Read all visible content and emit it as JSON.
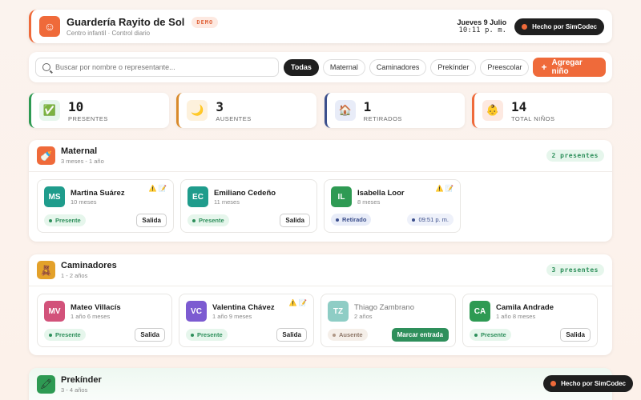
{
  "header": {
    "title": "Guardería Rayito de Sol",
    "badge": "DEMO",
    "subtitle": "Centro infantil · Control diario",
    "date": "Jueves 9 Julio",
    "time": "10:11 p. m.",
    "made_by": "Hecho por SimCodec"
  },
  "toolbar": {
    "search_placeholder": "Buscar por nombre o representante...",
    "filters": [
      "Todas",
      "Maternal",
      "Caminadores",
      "Prekínder",
      "Preescolar"
    ],
    "add_label": "Agregar niño"
  },
  "stats": [
    {
      "value": "10",
      "label": "PRESENTES",
      "icon": "check-icon"
    },
    {
      "value": "3",
      "label": "AUSENTES",
      "icon": "moon-icon"
    },
    {
      "value": "1",
      "label": "RETIRADOS",
      "icon": "house-icon"
    },
    {
      "value": "14",
      "label": "TOTAL NIÑOS",
      "icon": "baby-icon"
    }
  ],
  "sections": [
    {
      "title": "Maternal",
      "subtitle": "3 meses - 1 año",
      "count": "2 presentes",
      "icon": "bottle-icon",
      "children": [
        {
          "initials": "MS",
          "name": "Martina Suárez",
          "age": "10 meses",
          "status": "Presente",
          "action": "Salida",
          "color": "#1f9c8c",
          "flags": "⚠️ 📝"
        },
        {
          "initials": "EC",
          "name": "Emiliano Cedeño",
          "age": "11 meses",
          "status": "Presente",
          "action": "Salida",
          "color": "#1f9c8c",
          "flags": ""
        },
        {
          "initials": "IL",
          "name": "Isabella Loor",
          "age": "8 meses",
          "status": "Retirado",
          "action": "09:51 p. m.",
          "color": "#2e9a53",
          "flags": "⚠️ 📝"
        }
      ]
    },
    {
      "title": "Caminadores",
      "subtitle": "1 - 2 años",
      "count": "3 presentes",
      "icon": "bear-icon",
      "children": [
        {
          "initials": "MV",
          "name": "Mateo Villacís",
          "age": "1 año 6 meses",
          "status": "Presente",
          "action": "Salida",
          "color": "#d2527a",
          "flags": ""
        },
        {
          "initials": "VC",
          "name": "Valentina Chávez",
          "age": "1 año 9 meses",
          "status": "Presente",
          "action": "Salida",
          "color": "#7c5bd1",
          "flags": "⚠️ 📝"
        },
        {
          "initials": "TZ",
          "name": "Thiago Zambrano",
          "age": "2 años",
          "status": "Ausente",
          "action": "Marcar entrada",
          "color": "#1f9c8c",
          "flags": ""
        },
        {
          "initials": "CA",
          "name": "Camila Andrade",
          "age": "1 año 8 meses",
          "status": "Presente",
          "action": "Salida",
          "color": "#2e9a53",
          "flags": ""
        }
      ]
    },
    {
      "title": "Prekínder",
      "subtitle": "3 - 4 años",
      "icon": "crayon-icon"
    }
  ],
  "floating": {
    "made_by": "Hecho por SimCodec"
  },
  "colors": {
    "accent": "#ef6a3a",
    "present": "#2e8f5b",
    "retired": "#3c4f8c"
  }
}
